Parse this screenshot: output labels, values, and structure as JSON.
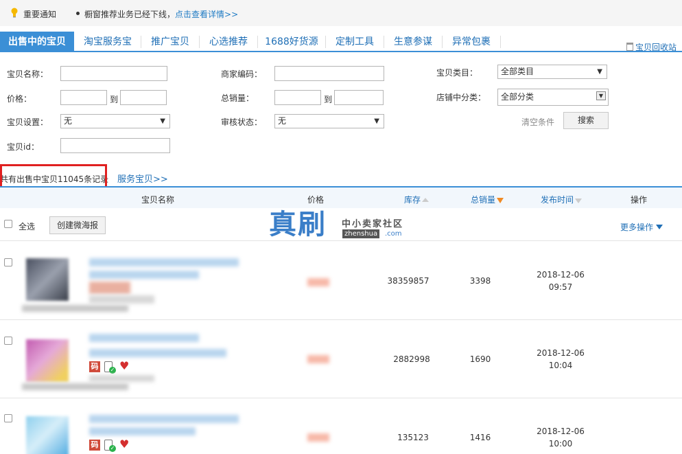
{
  "notice": {
    "title": "重要通知",
    "message": "橱窗推荐业务已经下线，",
    "link": "点击查看详情>>"
  },
  "tabs": [
    {
      "label": "出售中的宝贝",
      "active": true
    },
    {
      "label": "淘宝服务宝",
      "active": false
    },
    {
      "label": "推广宝贝",
      "active": false
    },
    {
      "label": "心选推荐",
      "active": false
    },
    {
      "label": "1688好货源",
      "active": false
    },
    {
      "label": "定制工具",
      "active": false
    },
    {
      "label": "生意参谋",
      "active": false
    },
    {
      "label": "异常包裹",
      "active": false
    }
  ],
  "recycle_label": "宝贝回收站",
  "filters": {
    "name_label": "宝贝名称：",
    "name_value": "",
    "merchant_code_label": "商家编码：",
    "merchant_code_value": "",
    "category_label": "宝贝类目：",
    "category_value": "全部类目",
    "price_label": "价格：",
    "price_to": "到",
    "total_sales_label": "总销量：",
    "sales_to": "到",
    "shop_category_label": "店铺中分类：",
    "shop_category_value": "全部分类",
    "setting_label": "宝贝设置：",
    "setting_value": "无",
    "review_label": "审核状态：",
    "review_value": "无",
    "id_label": "宝贝id：",
    "id_value": "",
    "clear_label": "清空条件",
    "search_label": "搜索"
  },
  "summary": {
    "count_text": "共有出售中宝贝11045条记录",
    "service_link": "服务宝贝>>"
  },
  "columns": {
    "name": "宝贝名称",
    "price": "价格",
    "stock": "库存",
    "sales": "总销量",
    "publish_time": "发布时间",
    "ops": "操作"
  },
  "toolbar": {
    "select_all": "全选",
    "create_poster": "创建微海报",
    "more_ops": "更多操作"
  },
  "watermark": {
    "big": "真刷",
    "small": "中小卖家社区",
    "domain": "zhenshua",
    "com": ".com"
  },
  "rows": [
    {
      "stock": "38359857",
      "sales": "3398",
      "date": "2018-12-06",
      "time": "09:57"
    },
    {
      "stock": "2882998",
      "sales": "1690",
      "date": "2018-12-06",
      "time": "10:04"
    },
    {
      "stock": "135123",
      "sales": "1416",
      "date": "2018-12-06",
      "time": "10:00"
    }
  ],
  "icons": {
    "ma_label": "码",
    "colors": {
      "accent": "#3b8fd6",
      "link": "#1f6fb6",
      "highlight": "#e02020"
    }
  }
}
